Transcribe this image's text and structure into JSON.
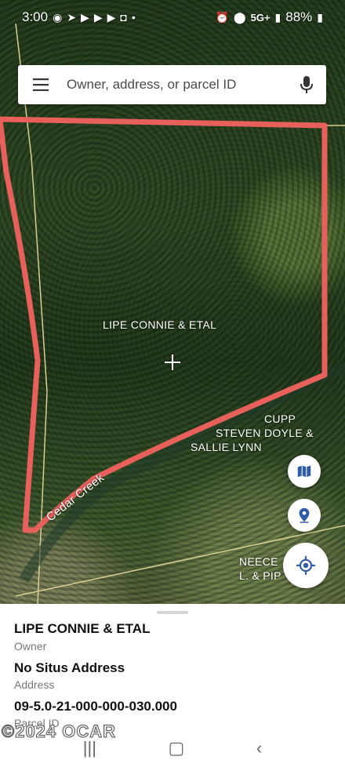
{
  "status_bar": {
    "time": "3:00",
    "network": "5G+",
    "battery": "88%"
  },
  "search": {
    "placeholder": "Owner, address, or parcel ID"
  },
  "map": {
    "parcel_label": "LIPE CONNIE & ETAL",
    "neighbor1_line1": "CUPP",
    "neighbor1_line2": "STEVEN DOYLE &",
    "neighbor1_line3": "SALLIE LYNN",
    "neighbor2_line1": "NEECE",
    "neighbor2_line2": "L. & PIP",
    "creek_label": "Cedar Creek",
    "parcel_outline_color": "#e8605c"
  },
  "sheet": {
    "owner_value": "LIPE CONNIE & ETAL",
    "owner_label": "Owner",
    "address_value": "No Situs Address",
    "address_label": "Address",
    "parcel_value": "09-5.0-21-000-000-030.000",
    "parcel_label": "Parcel ID"
  },
  "watermark": "©2024 OCAR",
  "accent_color": "#2f5ba7"
}
